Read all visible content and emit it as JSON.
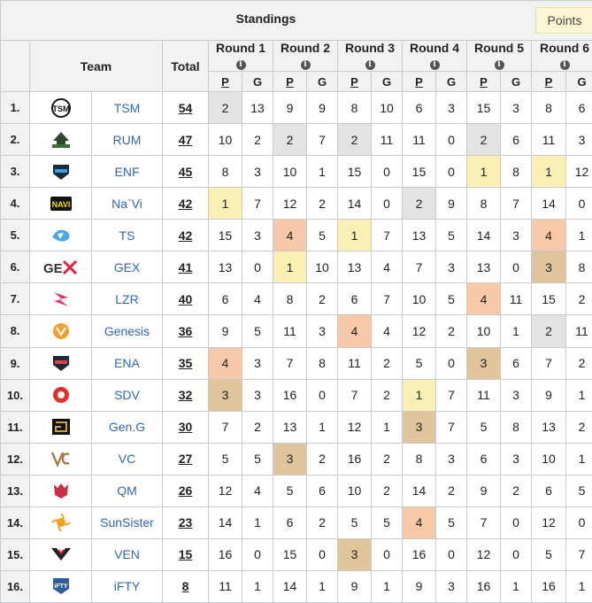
{
  "header": {
    "title": "Standings",
    "points_button": "Points",
    "team_label": "Team",
    "total_label": "Total",
    "info_glyph": "i",
    "points_sub": "P",
    "games_sub": "G"
  },
  "rounds": [
    "Round 1",
    "Round 2",
    "Round 3",
    "Round 4",
    "Round 5",
    "Round 6"
  ],
  "highlight_colors": {
    "gray": "#e3e3e3",
    "gold": "#fbf0b4",
    "silver": "#f7c9a8",
    "bronze": "#dfc49c"
  },
  "rows": [
    {
      "rank": "1.",
      "team": "TSM",
      "logo": "tsm-logo-icon",
      "total": "54",
      "cells": [
        "2",
        "13",
        "9",
        "9",
        "8",
        "10",
        "6",
        "3",
        "15",
        "3",
        "8",
        "6"
      ]
    },
    {
      "rank": "2.",
      "team": "RUM",
      "logo": "rum-logo-icon",
      "total": "47",
      "cells": [
        "10",
        "2",
        "2",
        "7",
        "2",
        "11",
        "11",
        "0",
        "2",
        "6",
        "11",
        "3"
      ]
    },
    {
      "rank": "3.",
      "team": "ENF",
      "logo": "enf-logo-icon",
      "total": "45",
      "cells": [
        "8",
        "3",
        "10",
        "1",
        "15",
        "0",
        "15",
        "0",
        "1",
        "8",
        "1",
        "12"
      ]
    },
    {
      "rank": "4.",
      "team": "Na`Vi",
      "logo": "navi-logo-icon",
      "total": "42",
      "cells": [
        "1",
        "7",
        "12",
        "2",
        "14",
        "0",
        "2",
        "9",
        "8",
        "7",
        "14",
        "0"
      ]
    },
    {
      "rank": "5.",
      "team": "TS",
      "logo": "ts-logo-icon",
      "total": "42",
      "cells": [
        "15",
        "3",
        "4",
        "5",
        "1",
        "7",
        "13",
        "5",
        "14",
        "3",
        "4",
        "1"
      ]
    },
    {
      "rank": "6.",
      "team": "GEX",
      "logo": "gex-logo-icon",
      "total": "41",
      "cells": [
        "13",
        "0",
        "1",
        "10",
        "13",
        "4",
        "7",
        "3",
        "13",
        "0",
        "3",
        "8"
      ]
    },
    {
      "rank": "7.",
      "team": "LZR",
      "logo": "lzr-logo-icon",
      "total": "40",
      "cells": [
        "6",
        "4",
        "8",
        "2",
        "6",
        "7",
        "10",
        "5",
        "4",
        "11",
        "15",
        "2"
      ]
    },
    {
      "rank": "8.",
      "team": "Genesis",
      "logo": "genesis-logo-icon",
      "total": "36",
      "cells": [
        "9",
        "5",
        "11",
        "3",
        "4",
        "4",
        "12",
        "2",
        "10",
        "1",
        "2",
        "11"
      ]
    },
    {
      "rank": "9.",
      "team": "ENA",
      "logo": "ena-logo-icon",
      "total": "35",
      "cells": [
        "4",
        "3",
        "7",
        "8",
        "11",
        "2",
        "5",
        "0",
        "3",
        "6",
        "7",
        "2"
      ]
    },
    {
      "rank": "10.",
      "team": "SDV",
      "logo": "sdv-logo-icon",
      "total": "32",
      "cells": [
        "3",
        "3",
        "16",
        "0",
        "7",
        "2",
        "1",
        "7",
        "11",
        "3",
        "9",
        "1"
      ]
    },
    {
      "rank": "11.",
      "team": "Gen.G",
      "logo": "geng-logo-icon",
      "total": "30",
      "cells": [
        "7",
        "2",
        "13",
        "1",
        "12",
        "1",
        "3",
        "7",
        "5",
        "8",
        "13",
        "2"
      ]
    },
    {
      "rank": "12.",
      "team": "VC",
      "logo": "vc-logo-icon",
      "total": "27",
      "cells": [
        "5",
        "5",
        "3",
        "2",
        "16",
        "2",
        "8",
        "3",
        "6",
        "3",
        "10",
        "1"
      ]
    },
    {
      "rank": "13.",
      "team": "QM",
      "logo": "qm-logo-icon",
      "total": "26",
      "cells": [
        "12",
        "4",
        "5",
        "6",
        "10",
        "2",
        "14",
        "2",
        "9",
        "2",
        "6",
        "5"
      ]
    },
    {
      "rank": "14.",
      "team": "SunSister",
      "logo": "sunsister-logo-icon",
      "total": "23",
      "cells": [
        "14",
        "1",
        "6",
        "2",
        "5",
        "5",
        "4",
        "5",
        "7",
        "0",
        "12",
        "0"
      ]
    },
    {
      "rank": "15.",
      "team": "VEN",
      "logo": "ven-logo-icon",
      "total": "15",
      "cells": [
        "16",
        "0",
        "15",
        "0",
        "3",
        "0",
        "16",
        "0",
        "12",
        "0",
        "5",
        "7"
      ]
    },
    {
      "rank": "16.",
      "team": "iFTY",
      "logo": "ifty-logo-icon",
      "total": "8",
      "cells": [
        "11",
        "1",
        "14",
        "1",
        "9",
        "1",
        "9",
        "3",
        "16",
        "1",
        "16",
        "1"
      ]
    }
  ]
}
